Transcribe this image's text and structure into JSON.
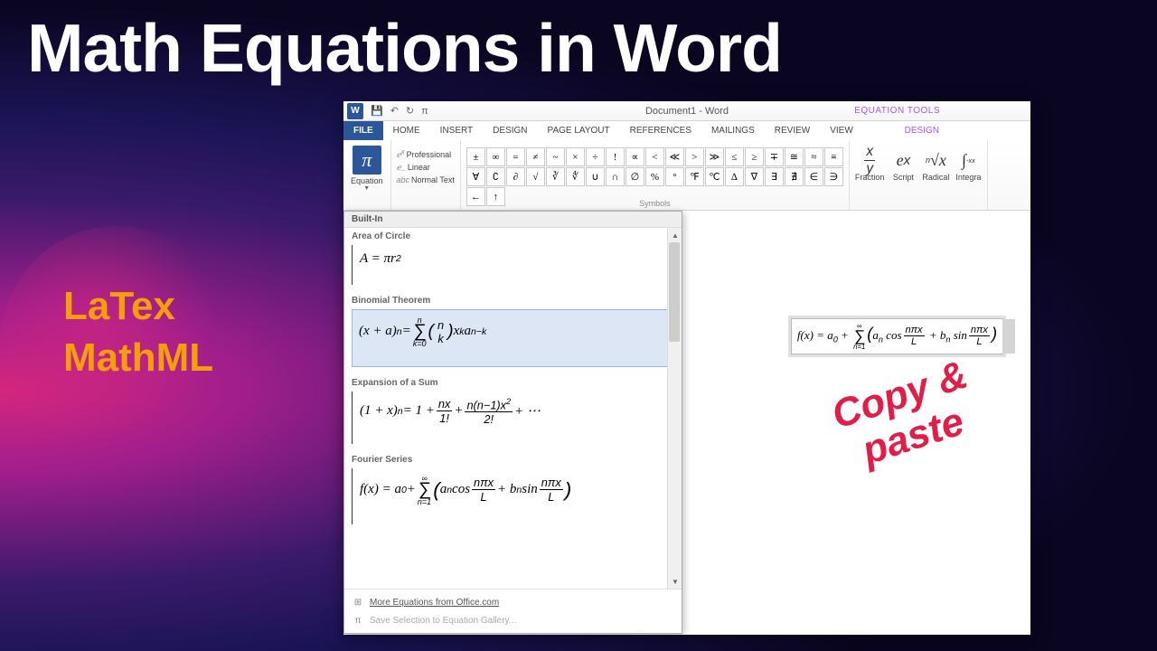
{
  "title": "Math Equations in Word",
  "side_text": {
    "line1": "LaTex",
    "line2": "MathML"
  },
  "callout": {
    "line1": "Copy &",
    "line2": "paste"
  },
  "window": {
    "doc_title": "Document1 - Word",
    "context_tab": "EQUATION TOOLS",
    "qat": {
      "save": "💾",
      "undo": "↶",
      "redo": "↻",
      "pi": "π"
    }
  },
  "tabs": {
    "file": "FILE",
    "home": "HOME",
    "insert": "INSERT",
    "design": "DESIGN",
    "page_layout": "PAGE LAYOUT",
    "references": "REFERENCES",
    "mailings": "MAILINGS",
    "review": "REVIEW",
    "view": "VIEW",
    "eq_design": "DESIGN"
  },
  "ribbon": {
    "equation_label": "Equation",
    "professional": "Professional",
    "linear": "Linear",
    "normal_text": "Normal Text",
    "symbols_label": "Symbols",
    "symbols_row1": [
      "±",
      "∞",
      "=",
      "≠",
      "~",
      "×",
      "÷",
      "!",
      "∝",
      "<",
      "≪",
      ">",
      "≫",
      "≤",
      "≥",
      "∓",
      "≅",
      "≈",
      "≡",
      "∀"
    ],
    "symbols_row2": [
      "∁",
      "∂",
      "√",
      "∛",
      "∜",
      "∪",
      "∩",
      "∅",
      "%",
      "°",
      "℉",
      "℃",
      "∆",
      "∇",
      "∃",
      "∄",
      "∈",
      "∋",
      "←",
      "↑"
    ],
    "structures": {
      "fraction": "Fraction",
      "script": "Script",
      "radical": "Radical",
      "integral": "Integra"
    }
  },
  "dropdown": {
    "header": "Built-In",
    "items": [
      {
        "title": "Area of Circle",
        "eq": "A = πr²"
      },
      {
        "title": "Binomial Theorem",
        "eq": "binomial"
      },
      {
        "title": "Expansion of a Sum",
        "eq": "expansion"
      },
      {
        "title": "Fourier Series",
        "eq": "fourier"
      }
    ],
    "more": "More Equations from Office.com",
    "save": "Save Selection to Equation Gallery..."
  },
  "inline_equation": "fourier"
}
